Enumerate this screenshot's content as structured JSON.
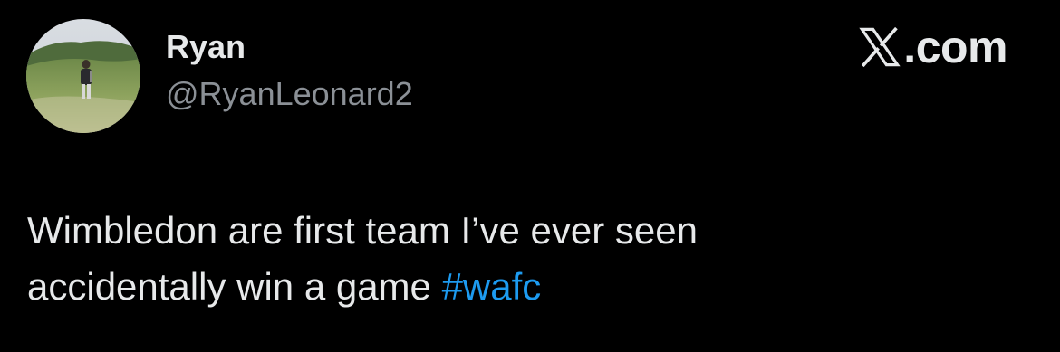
{
  "author": {
    "display_name": "Ryan",
    "handle": "@RyanLeonard2",
    "avatar_icon": "profile-photo-person-on-hill"
  },
  "brand": {
    "logo_icon": "x-logo-icon",
    "domain": ".com"
  },
  "tweet": {
    "line1": "Wimbledon are first team I’ve ever seen",
    "line2_text": "accidentally win a game ",
    "hashtag": "#wafc"
  },
  "colors": {
    "background": "#000000",
    "text_primary": "#e7e9ea",
    "text_secondary": "#8b9096",
    "hashtag": "#1d9bf0"
  }
}
